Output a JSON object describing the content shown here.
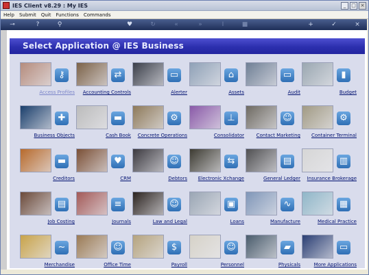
{
  "window": {
    "title": "IES Client v8.29 : My IES"
  },
  "menu": {
    "items": [
      "Help",
      "Submit",
      "Quit",
      "Functions",
      "Commands"
    ]
  },
  "header": {
    "title": "Select Application @ IES Business"
  },
  "colors": {
    "header": "#2c2fae",
    "panel": "#d9dcec",
    "link": "#001070",
    "toolbar": "#2e4170"
  },
  "tiles": [
    {
      "label": "Access Profiles",
      "icon": "key-icon",
      "photo": "#b58c7d"
    },
    {
      "label": "Accounting Controls",
      "icon": "controls-icon",
      "photo": "#7c6248"
    },
    {
      "label": "Alerter",
      "icon": "router-icon",
      "photo": "#3b3f4a"
    },
    {
      "label": "Assets",
      "icon": "home-icon",
      "photo": "#8fa1b7"
    },
    {
      "label": "Audit",
      "icon": "monitor-icon",
      "photo": "#6f7f95"
    },
    {
      "label": "Budget",
      "icon": "bar-chart-icon",
      "photo": "#9aa7b1"
    },
    {
      "label": "Business Objects",
      "icon": "puzzle-icon",
      "photo": "#1b3f6c"
    },
    {
      "label": "Cash Book",
      "icon": "card-icon",
      "photo": "#bcbcbc"
    },
    {
      "label": "Concrete Operations",
      "icon": "gears-icon",
      "photo": "#8e7a5a"
    },
    {
      "label": "Consolidator",
      "icon": "org-chart-icon",
      "photo": "#8a5aa8"
    },
    {
      "label": "Contact Marketing",
      "icon": "people-icon",
      "photo": "#6e6a62"
    },
    {
      "label": "Container Terminal",
      "icon": "gears-icon",
      "photo": "#a19a84"
    },
    {
      "label": "Creditors",
      "icon": "card-icon",
      "photo": "#b76a2c"
    },
    {
      "label": "CRM",
      "icon": "heart-icon",
      "photo": "#7b5036"
    },
    {
      "label": "Debtors",
      "icon": "people-icon",
      "photo": "#3c3a40"
    },
    {
      "label": "Electronic Xchange",
      "icon": "exchange-icon",
      "photo": "#3d3b32"
    },
    {
      "label": "General Ledger",
      "icon": "clipboard-icon",
      "photo": "#505052"
    },
    {
      "label": "Insurance Brokerage",
      "icon": "printer-icon",
      "photo": "#d6d6d6"
    },
    {
      "label": "Job Costing",
      "icon": "document-icon",
      "photo": "#6b4a3a"
    },
    {
      "label": "Journals",
      "icon": "notes-icon",
      "photo": "#a35a58"
    },
    {
      "label": "Law and Legal",
      "icon": "people-icon",
      "photo": "#2c2420"
    },
    {
      "label": "Loans",
      "icon": "id-card-icon",
      "photo": "#9aa6b4"
    },
    {
      "label": "Manufacture",
      "icon": "chart-line-icon",
      "photo": "#7f96b8"
    },
    {
      "label": "Medical Practice",
      "icon": "windows-icon",
      "photo": "#8fb6c8"
    },
    {
      "label": "Merchandise",
      "icon": "swoosh-icon",
      "photo": "#c8a34a"
    },
    {
      "label": "Office Time",
      "icon": "people-icon",
      "photo": "#9b7b55"
    },
    {
      "label": "Payroll",
      "icon": "money-icon",
      "photo": "#b5a37e"
    },
    {
      "label": "Personnel",
      "icon": "people-icon",
      "photo": "#d6d2c8"
    },
    {
      "label": "Physicals",
      "icon": "truck-icon",
      "photo": "#4a5c6c"
    },
    {
      "label": "More Applications",
      "icon": "monitor-icon",
      "photo": "#2b3f74"
    }
  ]
}
